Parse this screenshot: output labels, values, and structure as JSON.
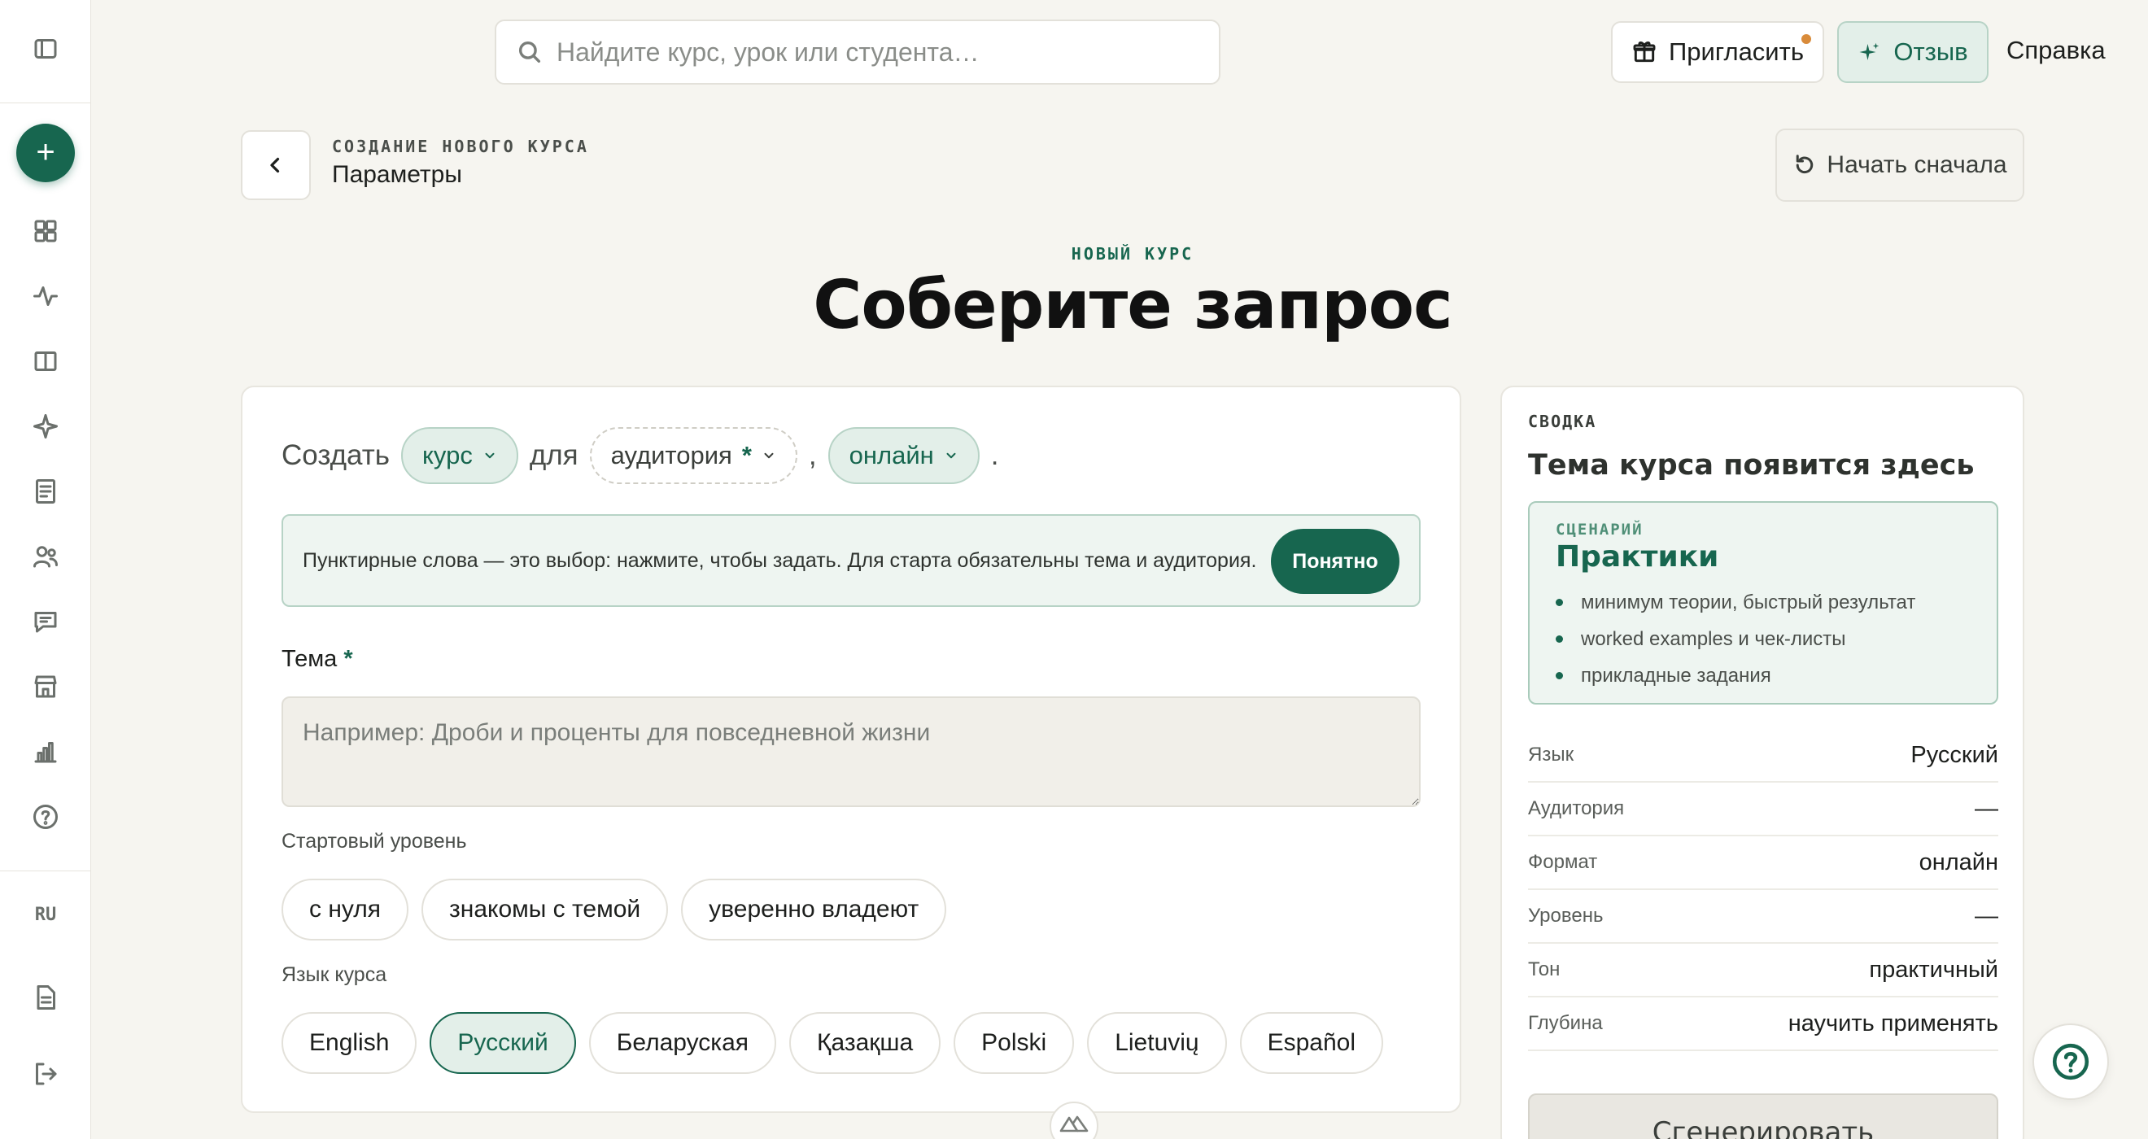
{
  "sidebar": {
    "icons": [
      "sidebar-toggle-icon",
      "dashboard-icon",
      "activity-icon",
      "book-icon",
      "sparkle-icon",
      "document-list-icon",
      "users-icon",
      "chat-icon",
      "store-icon",
      "stats-icon",
      "help-circle-icon",
      "file-icon",
      "logout-icon"
    ],
    "lang": "RU"
  },
  "topbar": {
    "search_placeholder": "Найдите курс, урок или студента…",
    "invite_label": "Пригласить",
    "review_label": "Отзыв",
    "help_label": "Справка"
  },
  "header": {
    "overline": "СОЗДАНИЕ НОВОГО КУРСА",
    "title": "Параметры",
    "restart_label": "Начать сначала"
  },
  "hero": {
    "eyebrow": "НОВЫЙ КУРС",
    "title": "Соберите запрос"
  },
  "builder": {
    "sentence": {
      "create": "Создать",
      "type_chip": "курс",
      "for": "для",
      "audience_chip": "аудитория",
      "audience_required": "*",
      "comma": ",",
      "format_chip": "онлайн",
      "period": "."
    },
    "hint": {
      "text": "Пунктирные слова — это выбор: нажмите, чтобы задать. Для старта обязательны тема и аудитория.",
      "ok_label": "Понятно"
    },
    "topic": {
      "label": "Тема",
      "required": "*",
      "placeholder": "Например: Дроби и проценты для повседневной жизни",
      "value": ""
    },
    "level": {
      "label": "Стартовый уровень",
      "options": [
        "с нуля",
        "знакомы с темой",
        "уверенно владеют"
      ]
    },
    "language": {
      "label": "Язык курса",
      "options": [
        "English",
        "Русский",
        "Беларуская",
        "Қазақша",
        "Polski",
        "Lietuvių",
        "Español"
      ],
      "selected": "Русский"
    }
  },
  "summary": {
    "overline": "СВОДКА",
    "title": "Тема курса появится здесь",
    "scenario": {
      "overline": "СЦЕНАРИЙ",
      "title": "Практики",
      "bullets": [
        "минимум теории, быстрый результат",
        "worked examples и чек-листы",
        "прикладные задания"
      ]
    },
    "rows": [
      {
        "key": "Язык",
        "value": "Русский"
      },
      {
        "key": "Аудитория",
        "value": "—"
      },
      {
        "key": "Формат",
        "value": "онлайн"
      },
      {
        "key": "Уровень",
        "value": "—"
      },
      {
        "key": "Тон",
        "value": "практичный"
      },
      {
        "key": "Глубина",
        "value": "научить применять"
      }
    ],
    "generate_label": "Сгенерировать"
  },
  "colors": {
    "accent": "#17664f",
    "accent_soft": "#e3efe9",
    "page_bg": "#f6f5f0",
    "notify_dot": "#d98b3a"
  }
}
